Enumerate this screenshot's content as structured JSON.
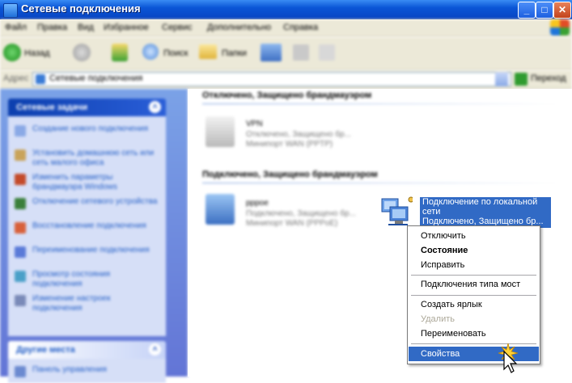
{
  "window": {
    "title": "Сетевые подключения",
    "min_label": "_",
    "max_label": "□",
    "close_label": "✕"
  },
  "menu": [
    "Файл",
    "Правка",
    "Вид",
    "Избранное",
    "Сервис",
    "Дополнительно",
    "Справка"
  ],
  "toolbar": {
    "back_label": "Назад",
    "search_label": "Поиск",
    "folders_label": "Папки"
  },
  "address": {
    "label": "Адрес",
    "value": "Сетевые подключения",
    "go_label": "Переход"
  },
  "left_pane": {
    "network_tasks_title": "Сетевые задачи",
    "tasks": [
      "Создание нового подключения",
      "Установить домашнюю сеть или сеть малого офиса",
      "Изменить параметры брандмауэра Windows",
      "Отключение сетевого устройства",
      "Восстановление подключения",
      "Переименование подключения",
      "Просмотр состояния подключения",
      "Изменение настроек подключения"
    ],
    "other_places_title": "Другие места",
    "other_places": [
      "Панель управления"
    ]
  },
  "content": {
    "group1": "Отключено, Защищено брандмауэром",
    "group2": "Подключено, Защищено брандмауэром",
    "conn_vpn": {
      "name": "VPN",
      "status": "Отключено, Защищено бр...",
      "device": "Минипорт WAN (PPTP)"
    },
    "conn_pppoe": {
      "name": "pppoe",
      "status": "Подключено, Защищено бр...",
      "device": "Минипорт WAN (PPPoE)"
    },
    "conn_lan": {
      "name_line1": "Подключение по локальной",
      "name_line2": "сети",
      "status": "Подключено, Защищено бр..."
    }
  },
  "context_menu": {
    "disconnect": "Отключить",
    "status": "Состояние",
    "repair": "Исправить",
    "bridge": "Подключения типа мост",
    "shortcut": "Создать ярлык",
    "delete": "Удалить",
    "rename": "Переименовать",
    "properties": "Свойства"
  },
  "colors": {
    "titlebar": "#0a55d6",
    "selection": "#316ac5",
    "taskpane": "#6375d6"
  }
}
